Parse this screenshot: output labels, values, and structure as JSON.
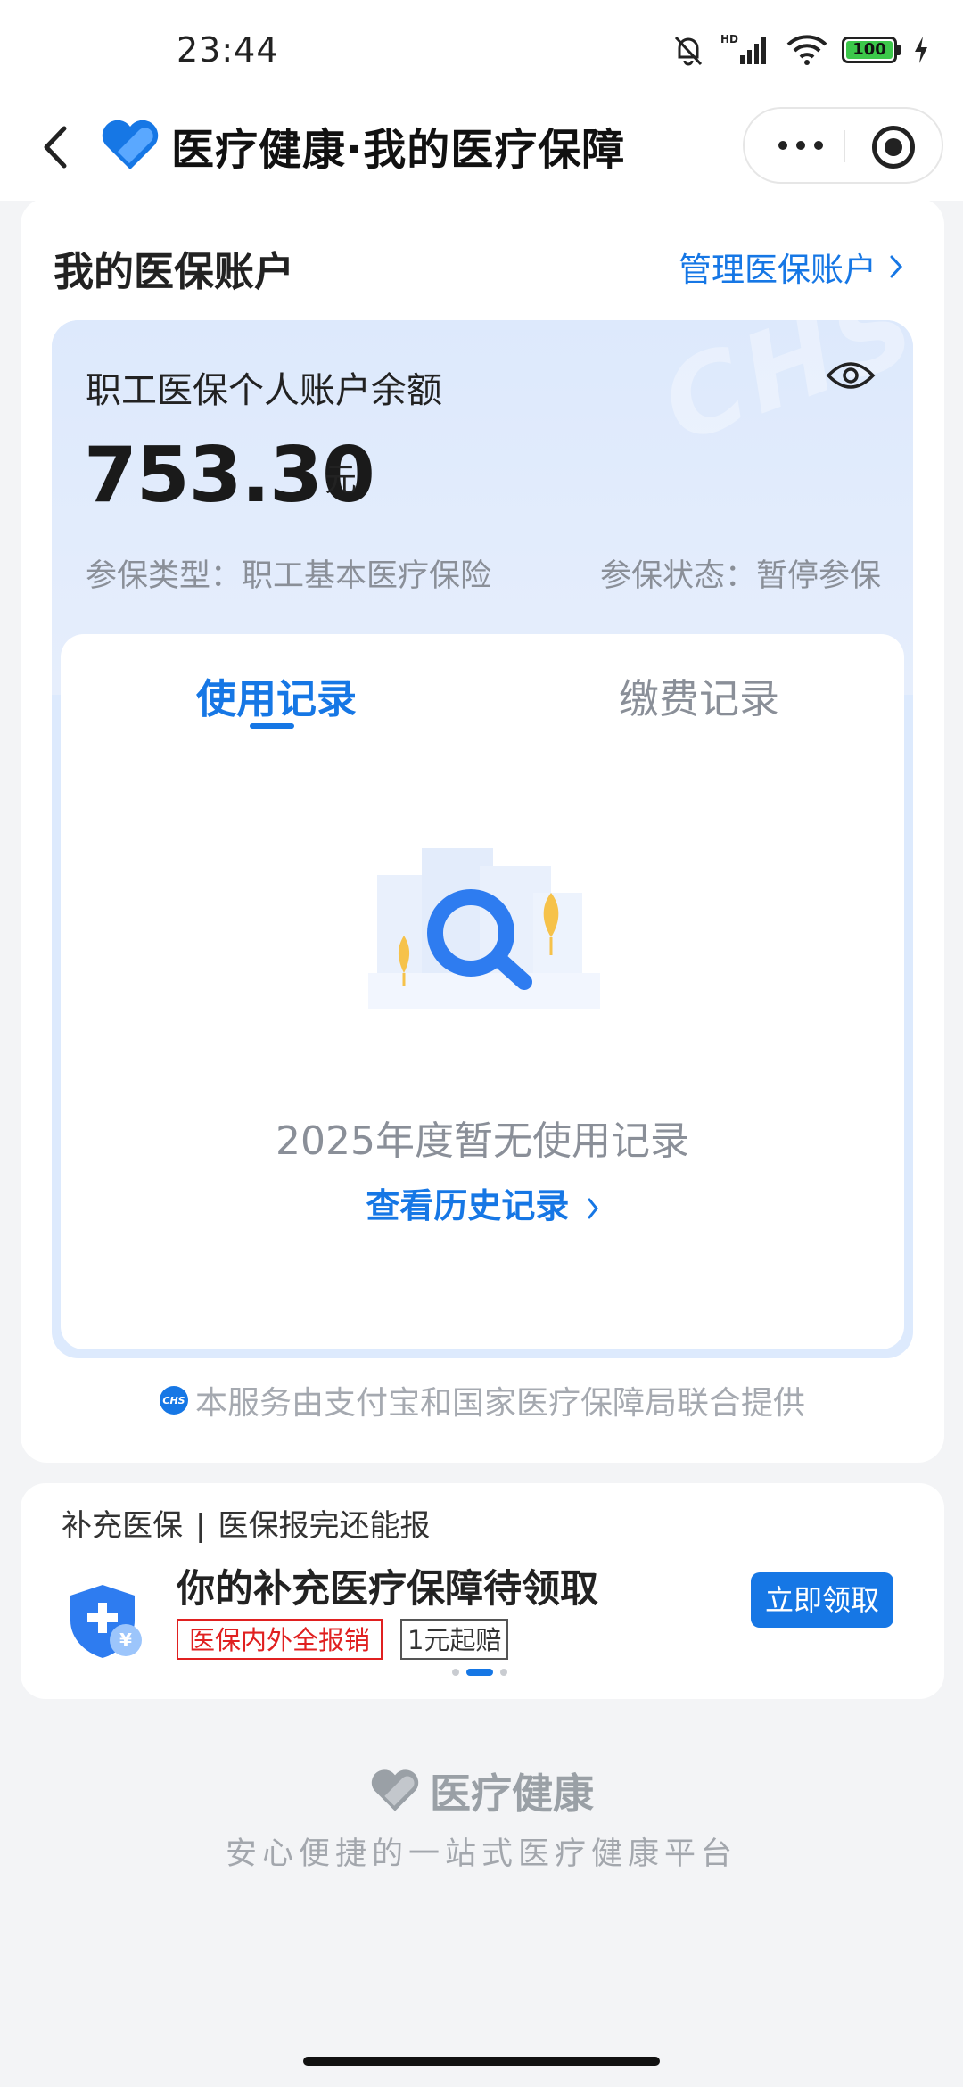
{
  "status_bar": {
    "time": "23:44",
    "battery": "100",
    "icons": [
      "bell-muted-icon",
      "hd-signal-icon",
      "wifi-icon",
      "battery-icon",
      "charging-icon"
    ]
  },
  "nav": {
    "title": "医疗健康·我的医疗保障",
    "icons": [
      "back-icon",
      "heart-pill-logo-icon",
      "more-icon",
      "close-target-icon"
    ]
  },
  "account": {
    "title": "我的医保账户",
    "manage_label": "管理医保账户",
    "balance_label": "职工医保个人账户余额",
    "balance_amount": "753.30",
    "currency": "元",
    "insurance_type": "参保类型：职工基本医疗保险",
    "insurance_status": "参保状态：暂停参保",
    "watermark": "CHS"
  },
  "records": {
    "tabs": [
      {
        "label": "使用记录",
        "active": true
      },
      {
        "label": "缴费记录",
        "active": false
      }
    ],
    "empty_text": "2025年度暂无使用记录",
    "history_link": "查看历史记录"
  },
  "provider": {
    "badge": "CHS",
    "text": "本服务由支付宝和国家医疗保障局联合提供"
  },
  "supplement": {
    "head_left": "补充医保",
    "head_sep": "|",
    "head_right": "医保报完还能报",
    "title": "你的补充医疗保障待领取",
    "tag1": "医保内外全报销",
    "tag2": "1元起赔",
    "button": "立即领取",
    "carousel_active_index": 1,
    "carousel_count": 3
  },
  "footer": {
    "brand": "医疗健康",
    "tagline": "安心便捷的一站式医疗健康平台"
  },
  "colors": {
    "accent": "#1677e5",
    "tag_red": "#e02020",
    "muted": "#8a8f98"
  }
}
